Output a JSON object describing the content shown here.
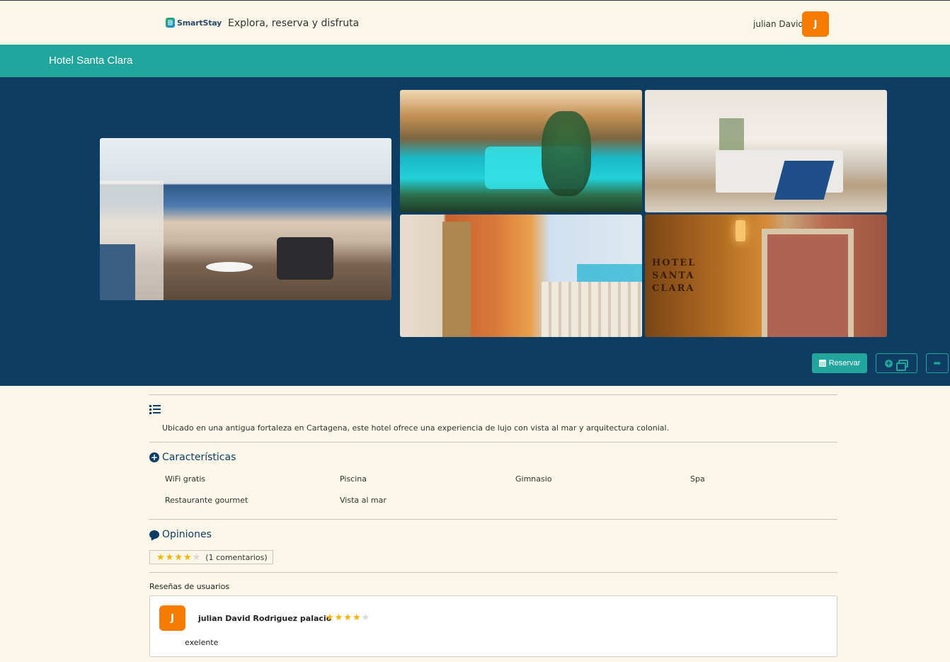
{
  "header": {
    "logo_text": "SmartStay",
    "tagline": "Explora, reserva y disfruta",
    "username": "julian David",
    "avatar_initial": "J"
  },
  "hotel": {
    "title": "Hotel Santa Clara",
    "description": "Ubicado en una antigua fortaleza en Cartagena, este hotel ofrece una experiencia de lujo con vista al mar y arquitectura colonial.",
    "facade_sign": "HOTEL SANTA CLARA"
  },
  "gallery": {
    "photos": [
      "terrace-photo",
      "pool-photo",
      "room-photo",
      "balcony-photo",
      "facade-photo"
    ]
  },
  "actions": {
    "reservar_label": "Reservar",
    "reservar_icon": "calendar-icon",
    "gallery_icons": [
      "plus-circle-icon",
      "images-icon"
    ],
    "share_icon": "share-icon"
  },
  "features": {
    "title": "Características",
    "items": [
      "WiFi gratis",
      "Piscina",
      "Gimnasio",
      "Spa",
      "Restaurante gourmet",
      "Vista al mar"
    ]
  },
  "opinions": {
    "title": "Opiniones",
    "rating": 4,
    "max_rating": 5,
    "count_text": "(1 comentarios)"
  },
  "reviews": {
    "label": "Reseñas de usuarios",
    "items": [
      {
        "initial": "J",
        "name": "julian David Rodriguez palacio",
        "rating": 4,
        "text": "exelente"
      }
    ]
  },
  "colors": {
    "teal": "#21a59c",
    "navy": "#0e3d63",
    "avatar_orange": "#f57c00",
    "star_gold": "#f5b400",
    "page_bg": "#faf7e8"
  }
}
